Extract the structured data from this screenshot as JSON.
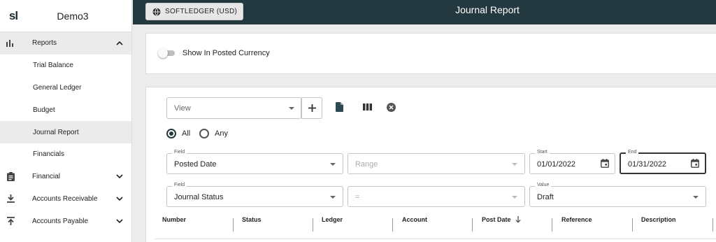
{
  "sidebar": {
    "logo": "sl",
    "company": "Demo3",
    "reports_label": "Reports",
    "report_items": [
      {
        "label": "Trial Balance"
      },
      {
        "label": "General Ledger"
      },
      {
        "label": "Budget"
      },
      {
        "label": "Journal Report"
      },
      {
        "label": "Financials"
      }
    ],
    "sections": [
      {
        "label": "Financial",
        "icon": "clipboard-icon"
      },
      {
        "label": "Accounts Receivable",
        "icon": "download-icon"
      },
      {
        "label": "Accounts Payable",
        "icon": "upload-icon"
      }
    ]
  },
  "topbar": {
    "ledger_button": "SOFTLEDGER (USD)",
    "title": "Journal Report"
  },
  "settings": {
    "toggle_label": "Show In Posted Currency",
    "toggle_on": false
  },
  "filters": {
    "view_placeholder": "View",
    "match_options": [
      "All",
      "Any"
    ],
    "match_selected": "All",
    "row1": {
      "field_label": "Field",
      "field_value": "Posted Date",
      "operator_placeholder": "Range",
      "start_label": "Start",
      "start_value": "01/01/2022",
      "end_label": "End",
      "end_value": "01/31/2022"
    },
    "row2": {
      "field_label": "Field",
      "field_value": "Journal Status",
      "operator_value": "=",
      "value_label": "Value",
      "value_value": "Draft"
    }
  },
  "table": {
    "columns": [
      "Number",
      "Status",
      "Ledger",
      "Account",
      "Post Date",
      "Reference",
      "Description"
    ],
    "sort_column": "Post Date",
    "sort_direction": "desc"
  },
  "colors": {
    "topbar": "#24393f",
    "accent": "#2b4a52"
  }
}
